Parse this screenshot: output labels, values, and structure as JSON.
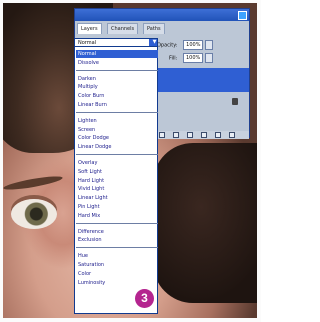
{
  "layers_panel": {
    "tabs": [
      {
        "label": "Layers"
      },
      {
        "label": "Channels"
      },
      {
        "label": "Paths"
      }
    ],
    "opacity_label": "Opacity:",
    "opacity_value": "100%",
    "fill_label": "Fill:",
    "fill_value": "100%"
  },
  "blend_mode_select": {
    "selected": "Normal"
  },
  "blend_mode_menu": {
    "groups": [
      [
        "Normal",
        "Dissolve"
      ],
      [
        "Darken",
        "Multiply",
        "Color Burn",
        "Linear Burn"
      ],
      [
        "Lighten",
        "Screen",
        "Color Dodge",
        "Linear Dodge"
      ],
      [
        "Overlay",
        "Soft Light",
        "Hard Light",
        "Vivid Light",
        "Linear Light",
        "Pin Light",
        "Hard Mix"
      ],
      [
        "Difference",
        "Exclusion"
      ],
      [
        "Hue",
        "Saturation",
        "Color",
        "Luminosity"
      ]
    ],
    "highlighted": "Normal"
  },
  "step_badge": "3",
  "colors": {
    "title_bar": "#2153b8",
    "selection": "#2f5fd3",
    "badge": "#b4248f"
  }
}
